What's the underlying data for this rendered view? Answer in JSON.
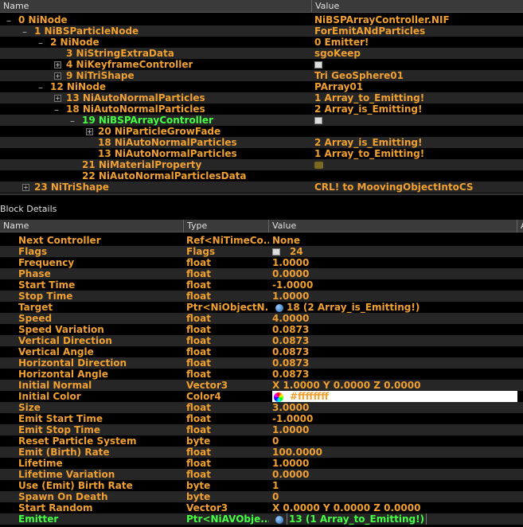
{
  "tree": {
    "col_name": "Name",
    "col_value": "Value",
    "rows": [
      {
        "label": "0 NiNode",
        "value": "NiBSPArrayController.NIF",
        "exp": "-"
      },
      {
        "label": "1 NiBSParticleNode",
        "value": "ForEmitANdParticles",
        "exp": "-"
      },
      {
        "label": "2 NiNode",
        "value": "0 Emitter!",
        "exp": "-"
      },
      {
        "label": "3 NiStringExtraData",
        "value": "sgoKeep",
        "exp": ""
      },
      {
        "label": "4 NiKeyframeController",
        "value": "",
        "exp": "+",
        "icon": "flag"
      },
      {
        "label": "9 NiTriShape",
        "value": "Tri GeoSphere01",
        "exp": "+"
      },
      {
        "label": "12 NiNode",
        "value": "PArray01",
        "exp": "-"
      },
      {
        "label": "13 NiAutoNormalParticles",
        "value": "1 Array_to_Emitting!",
        "exp": "+"
      },
      {
        "label": "18 NiAutoNormalParticles",
        "value": "2 Array_is_Emitting!",
        "exp": "-"
      },
      {
        "label": "19 NiBSPArrayController",
        "value": "",
        "exp": "-",
        "icon": "flag",
        "selected": true
      },
      {
        "label": "20 NiParticleGrowFade",
        "value": "",
        "exp": "+"
      },
      {
        "label": "18 NiAutoNormalParticles",
        "value": "2 Array_is_Emitting!",
        "exp": ""
      },
      {
        "label": "13 NiAutoNormalParticles",
        "value": "1 Array_to_Emitting!",
        "exp": ""
      },
      {
        "label": "21 NiMaterialProperty",
        "value": "",
        "exp": "",
        "icon": "material"
      },
      {
        "label": "22 NiAutoNormalParticlesData",
        "value": "",
        "exp": ""
      },
      {
        "label": "23 NiTriShape",
        "value": "CRL! to MoovingObjectIntoCS",
        "exp": "+"
      }
    ]
  },
  "details": {
    "title": "Block Details",
    "col_name": "Name",
    "col_type": "Type",
    "col_value": "Value",
    "col_extra": "A",
    "rows": [
      {
        "name": "Next Controller",
        "type": "Ref<NiTimeCo...",
        "value": "None"
      },
      {
        "name": "Flags",
        "type": "Flags",
        "value": "24",
        "icon": "flag"
      },
      {
        "name": "Frequency",
        "type": "float",
        "value": "1.0000"
      },
      {
        "name": "Phase",
        "type": "float",
        "value": "0.0000"
      },
      {
        "name": "Start Time",
        "type": "float",
        "value": "-1.0000"
      },
      {
        "name": "Stop Time",
        "type": "float",
        "value": "1.0000"
      },
      {
        "name": "Target",
        "type": "Ptr<NiObjectN...",
        "value": "18 (2 Array_is_Emitting!)",
        "icon": "link"
      },
      {
        "name": "Speed",
        "type": "float",
        "value": "4.0000"
      },
      {
        "name": "Speed Variation",
        "type": "float",
        "value": "0.0873"
      },
      {
        "name": "Vertical Direction",
        "type": "float",
        "value": "0.0873"
      },
      {
        "name": "Vertical Angle",
        "type": "float",
        "value": "0.0873"
      },
      {
        "name": "Horizontal Direction",
        "type": "float",
        "value": "0.0873"
      },
      {
        "name": "Horizontal Angle",
        "type": "float",
        "value": "0.0873"
      },
      {
        "name": "Initial Normal",
        "type": "Vector3",
        "value": "X 1.0000 Y 0.0000 Z 0.0000"
      },
      {
        "name": "Initial Color",
        "type": "Color4",
        "value": "#ffffffff",
        "icon": "color"
      },
      {
        "name": "Size",
        "type": "float",
        "value": "3.0000"
      },
      {
        "name": "Emit Start Time",
        "type": "float",
        "value": "-1.0000"
      },
      {
        "name": "Emit Stop Time",
        "type": "float",
        "value": "1.0000"
      },
      {
        "name": "Reset Particle System",
        "type": "byte",
        "value": "0"
      },
      {
        "name": "Emit (Birth) Rate",
        "type": "float",
        "value": "100.0000"
      },
      {
        "name": "Lifetime",
        "type": "float",
        "value": "1.0000"
      },
      {
        "name": "Lifetime Variation",
        "type": "float",
        "value": "0.0000"
      },
      {
        "name": "Use (Emit) Birth Rate",
        "type": "byte",
        "value": "1"
      },
      {
        "name": "Spawn On Death",
        "type": "byte",
        "value": "0"
      },
      {
        "name": "Start Random",
        "type": "Vector3",
        "value": "X 0.0000 Y 0.0000 Z 0.0000"
      },
      {
        "name": "Emitter",
        "type": "Ptr<NiAVObje...",
        "value": "13 (1 Array_to_Emitting!)",
        "icon": "link",
        "selected": true
      }
    ]
  },
  "colors": {
    "text": "#f0a030",
    "selected": "#44ff44",
    "alt_row": "#262626"
  }
}
